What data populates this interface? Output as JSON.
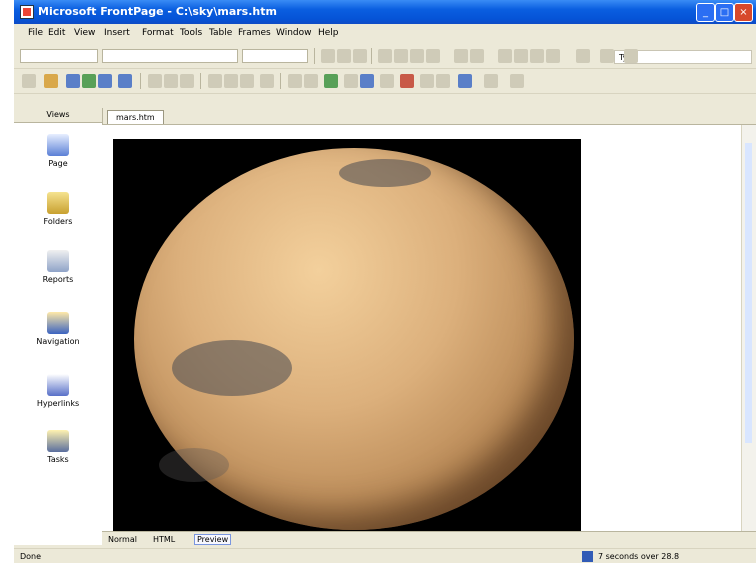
{
  "window": {
    "title": "Microsoft FrontPage - C:\\sky\\mars.htm"
  },
  "menu": [
    "File",
    "Edit",
    "View",
    "Insert",
    "Format",
    "Tools",
    "Table",
    "Frames",
    "Window",
    "Help"
  ],
  "help_box": {
    "placeholder": "Ty"
  },
  "views": {
    "header": "Views",
    "items": [
      {
        "label": "Page",
        "icon": "page-view-icon"
      },
      {
        "label": "Folders",
        "icon": "folders-view-icon"
      },
      {
        "label": "Reports",
        "icon": "reports-view-icon"
      },
      {
        "label": "Navigation",
        "icon": "navigation-view-icon"
      },
      {
        "label": "Hyperlinks",
        "icon": "hyperlinks-view-icon"
      },
      {
        "label": "Tasks",
        "icon": "tasks-view-icon"
      }
    ]
  },
  "document_tab": "mars.htm",
  "content": {
    "image": "mars-image"
  },
  "mode_tabs": [
    "Normal",
    "HTML",
    "Preview"
  ],
  "status": {
    "left": "Done",
    "right": "7 seconds over 28.8"
  },
  "colors": {
    "xp_blue": "#0553d6",
    "chrome": "#ece9d8",
    "editor_bg": "#ffffff",
    "mars": "#dcb07c"
  }
}
